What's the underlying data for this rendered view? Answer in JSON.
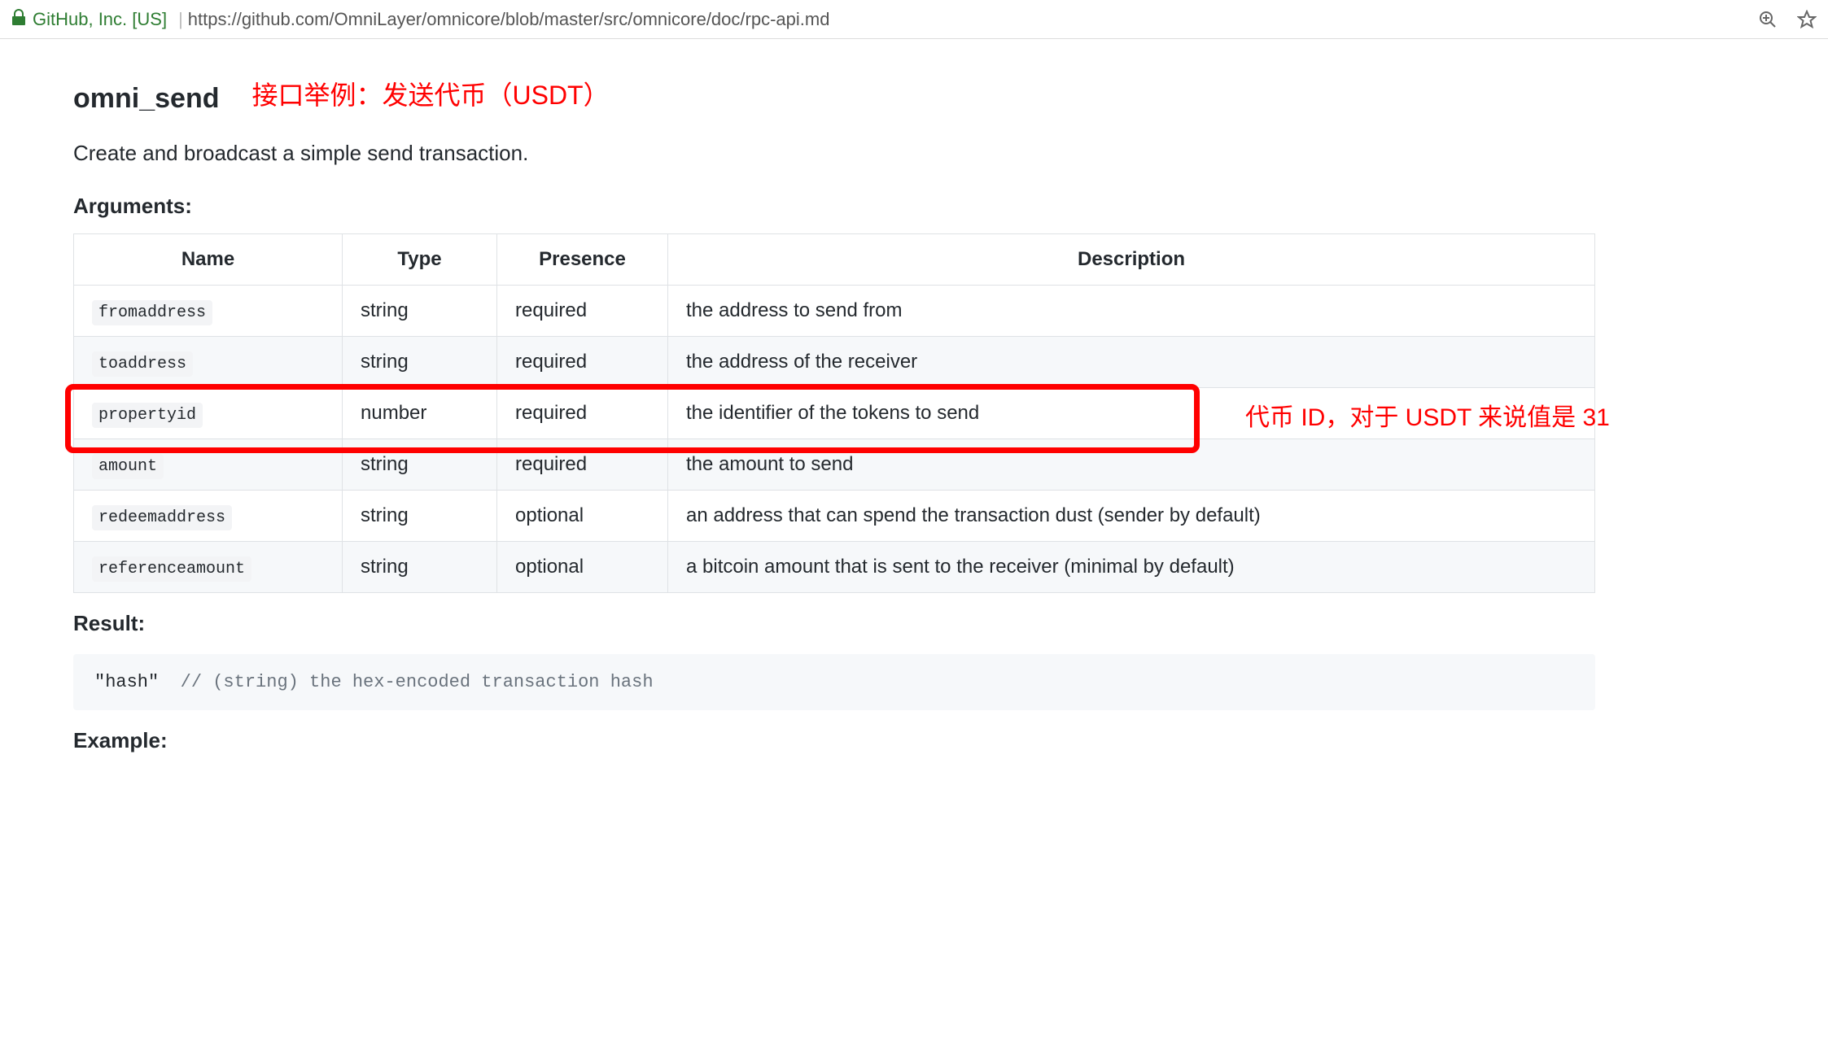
{
  "browser": {
    "site_identity": "GitHub, Inc. [US]",
    "url": "https://github.com/OmniLayer/omnicore/blob/master/src/omnicore/doc/rpc-api.md"
  },
  "page": {
    "api_name": "omni_send",
    "annotation_title": "接口举例：发送代币（USDT）",
    "description": "Create and broadcast a simple send transaction.",
    "arguments_label": "Arguments:",
    "result_label": "Result:",
    "example_label": "Example:"
  },
  "table": {
    "headers": {
      "name": "Name",
      "type": "Type",
      "presence": "Presence",
      "description": "Description"
    },
    "rows": [
      {
        "name": "fromaddress",
        "type": "string",
        "presence": "required",
        "description": "the address to send from"
      },
      {
        "name": "toaddress",
        "type": "string",
        "presence": "required",
        "description": "the address of the receiver"
      },
      {
        "name": "propertyid",
        "type": "number",
        "presence": "required",
        "description": "the identifier of the tokens to send"
      },
      {
        "name": "amount",
        "type": "string",
        "presence": "required",
        "description": "the amount to send"
      },
      {
        "name": "redeemaddress",
        "type": "string",
        "presence": "optional",
        "description": "an address that can spend the transaction dust (sender by default)"
      },
      {
        "name": "referenceamount",
        "type": "string",
        "presence": "optional",
        "description": "a bitcoin amount that is sent to the receiver (minimal by default)"
      }
    ]
  },
  "annotations": {
    "highlighted_row_index": 2,
    "side_note": "代币 ID，对于 USDT 来说值是 31"
  },
  "result_code": {
    "value": "\"hash\"",
    "spacer": "  ",
    "comment": "// (string) the hex-encoded transaction hash"
  }
}
